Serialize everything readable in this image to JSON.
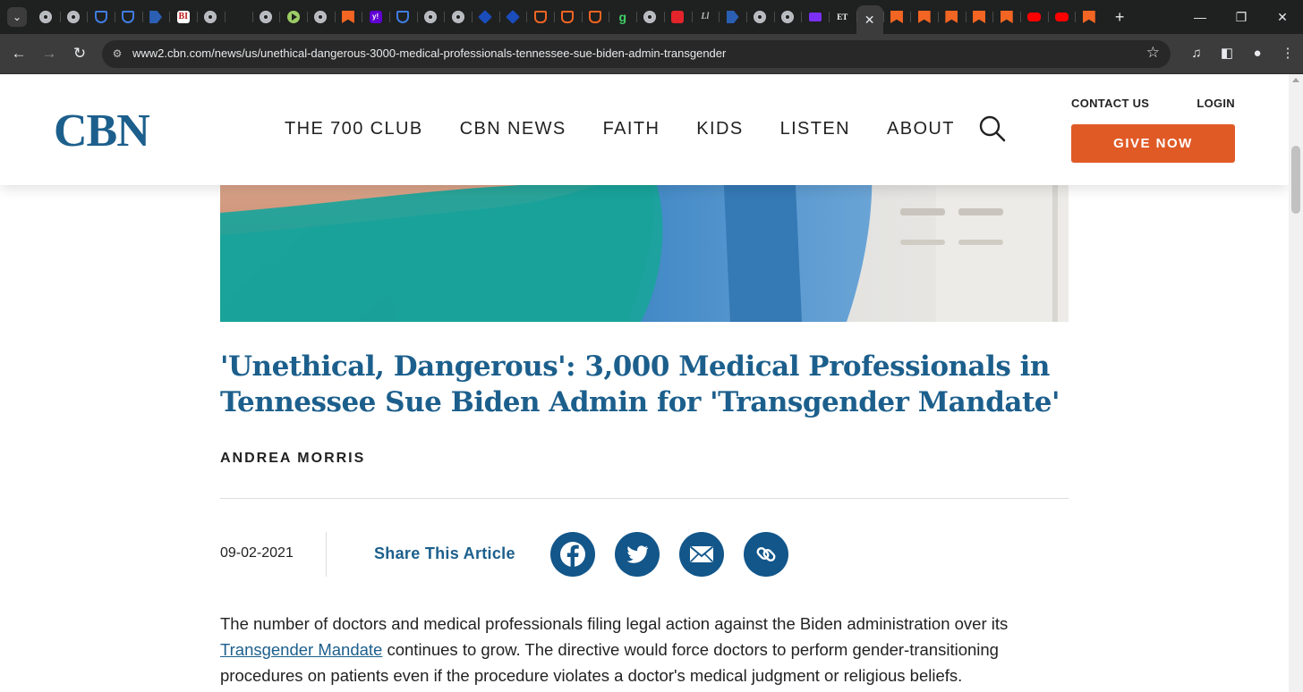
{
  "browser": {
    "tabs": [
      {
        "icon": "globe-icon"
      },
      {
        "icon": "globe-icon"
      },
      {
        "icon": "shield-icon"
      },
      {
        "icon": "shield-icon"
      },
      {
        "icon": "arrow-icon"
      },
      {
        "icon": "bi-icon",
        "text": "BI"
      },
      {
        "icon": "globe-icon"
      },
      {
        "icon": "search-icon"
      },
      {
        "icon": "globe-icon"
      },
      {
        "icon": "play-icon"
      },
      {
        "icon": "globe-icon"
      },
      {
        "icon": "ribbon-icon"
      },
      {
        "icon": "yahoo-icon",
        "text": "y!"
      },
      {
        "icon": "shield-icon"
      },
      {
        "icon": "globe-icon"
      },
      {
        "icon": "globe-icon"
      },
      {
        "icon": "cube-icon"
      },
      {
        "icon": "cube-icon"
      },
      {
        "icon": "brave-icon"
      },
      {
        "icon": "brave-icon"
      },
      {
        "icon": "brave-icon"
      },
      {
        "icon": "g-icon",
        "text": "g"
      },
      {
        "icon": "globe-icon"
      },
      {
        "icon": "mic-icon"
      },
      {
        "icon": "ll-icon",
        "text": "Ll"
      },
      {
        "icon": "arrow-icon"
      },
      {
        "icon": "globe-icon"
      },
      {
        "icon": "globe-icon"
      },
      {
        "icon": "envelope-icon"
      },
      {
        "icon": "et-icon",
        "text": "ET"
      }
    ],
    "tabs_after": [
      {
        "icon": "ribbon-icon"
      },
      {
        "icon": "ribbon-icon"
      },
      {
        "icon": "ribbon-icon"
      },
      {
        "icon": "ribbon-icon"
      },
      {
        "icon": "ribbon-icon"
      },
      {
        "icon": "youtube-icon"
      },
      {
        "icon": "youtube-icon"
      },
      {
        "icon": "ribbon-icon"
      }
    ],
    "active_tab_close": "✕",
    "url": "www2.cbn.com/news/us/unethical-dangerous-3000-medical-professionals-tennessee-sue-biden-admin-transgender"
  },
  "header": {
    "logo_text": "CBN",
    "nav": [
      "THE 700 CLUB",
      "CBN NEWS",
      "FAITH",
      "KIDS",
      "LISTEN",
      "ABOUT"
    ],
    "contact_label": "CONTACT US",
    "login_label": "LOGIN",
    "give_label": "GIVE NOW"
  },
  "article": {
    "title": "'Unethical, Dangerous': 3,000 Medical Professionals in Tennessee Sue Biden Admin for 'Transgender Mandate'",
    "author": "ANDREA MORRIS",
    "date": "09-02-2021",
    "share_label": "Share This Article",
    "share_icons": [
      "facebook-icon",
      "twitter-icon",
      "email-icon",
      "link-icon"
    ],
    "body_before_link": "The number of doctors and medical professionals filing legal action against the Biden administration over its ",
    "body_link": "Transgender Mandate",
    "body_after_link": " continues to grow. The directive would force doctors to perform gender-transitioning procedures on patients even if the procedure violates a doctor's medical judgment or religious beliefs."
  },
  "colors": {
    "brand_blue": "#1c5f8c",
    "share_blue": "#12568a",
    "give_orange": "#e05a26"
  }
}
